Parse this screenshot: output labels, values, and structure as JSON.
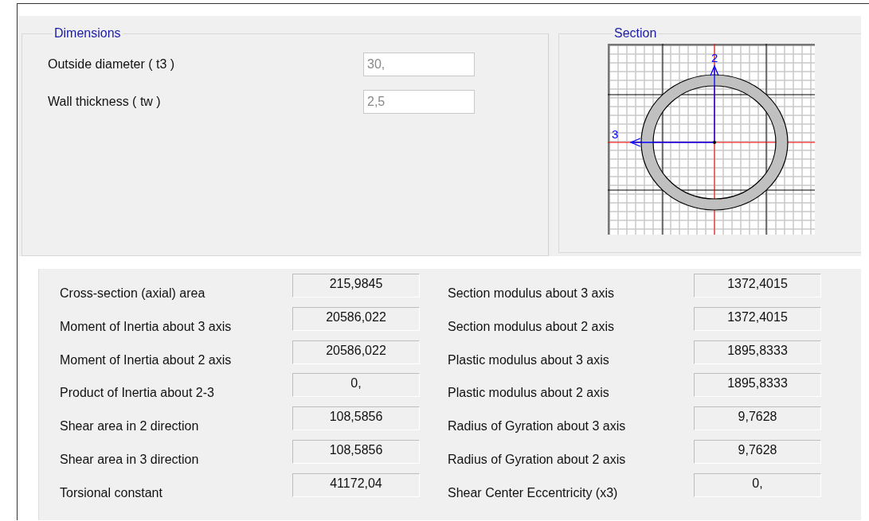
{
  "dimensions": {
    "title": "Dimensions",
    "fields": [
      {
        "label": "Outside diameter  ( t3 )",
        "value": "30,"
      },
      {
        "label": "Wall thickness  ( tw )",
        "value": "2,5"
      }
    ]
  },
  "section": {
    "title": "Section",
    "axis_2": "2",
    "axis_3": "3"
  },
  "properties": {
    "left": [
      {
        "label": "Cross-section (axial) area",
        "value": "215,9845"
      },
      {
        "label": "Moment of Inertia about 3 axis",
        "value": "20586,022"
      },
      {
        "label": "Moment of Inertia about 2 axis",
        "value": "20586,022"
      },
      {
        "label": "Product of Inertia about 2-3",
        "value": "0,"
      },
      {
        "label": "Shear area in 2 direction",
        "value": "108,5856"
      },
      {
        "label": "Shear area in 3 direction",
        "value": "108,5856"
      },
      {
        "label": "Torsional constant",
        "value": "41172,04"
      }
    ],
    "right": [
      {
        "label": "Section modulus about 3 axis",
        "value": "1372,4015"
      },
      {
        "label": "Section modulus about 2 axis",
        "value": "1372,4015"
      },
      {
        "label": "Plastic modulus about 3 axis",
        "value": "1895,8333"
      },
      {
        "label": "Plastic modulus about 2 axis",
        "value": "1895,8333"
      },
      {
        "label": "Radius of Gyration about 3 axis",
        "value": "9,7628"
      },
      {
        "label": "Radius of Gyration about 2 axis",
        "value": "9,7628"
      },
      {
        "label": "Shear Center Eccentricity (x3)",
        "value": "0,"
      }
    ]
  }
}
